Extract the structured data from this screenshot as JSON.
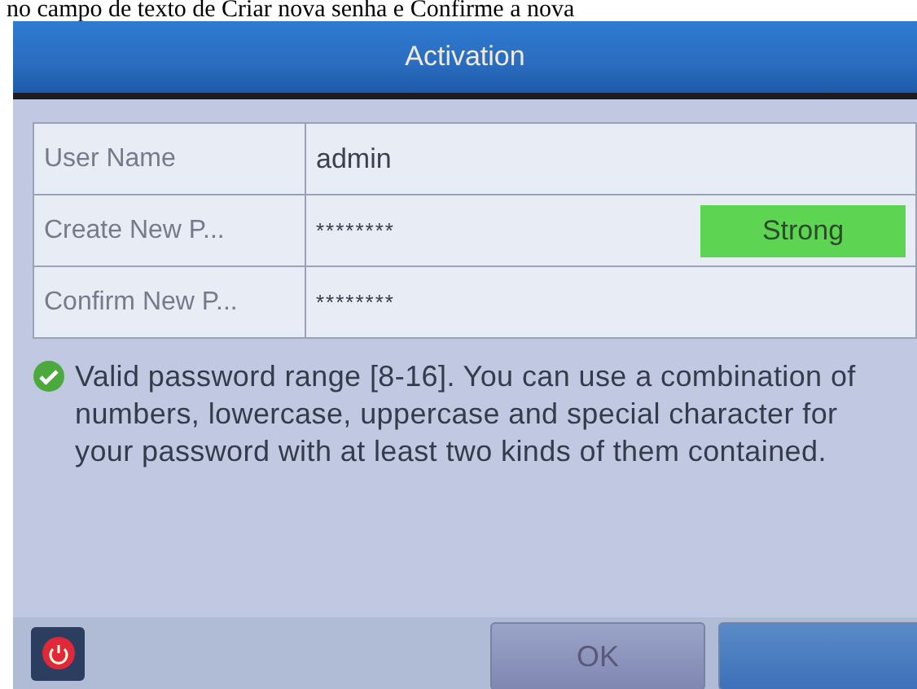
{
  "caption": "no campo de texto de Criar nova senha e Confirme a nova",
  "window": {
    "title": "Activation"
  },
  "fields": [
    {
      "label": "User Name",
      "value": "admin",
      "kind": "text"
    },
    {
      "label": "Create New P...",
      "value": "********",
      "kind": "password",
      "strength": {
        "label": "Strong",
        "level": 1
      }
    },
    {
      "label": "Confirm New P...",
      "value": "********",
      "kind": "password"
    }
  ],
  "message": {
    "valid": true,
    "text": "Valid password range [8-16]. You can use a combination of numbers, lowercase, uppercase and special character for your password with at least two kinds of them contained."
  },
  "buttons": [
    {
      "label": "OK",
      "kind": "ok"
    },
    {
      "kind": "cancel"
    }
  ]
}
